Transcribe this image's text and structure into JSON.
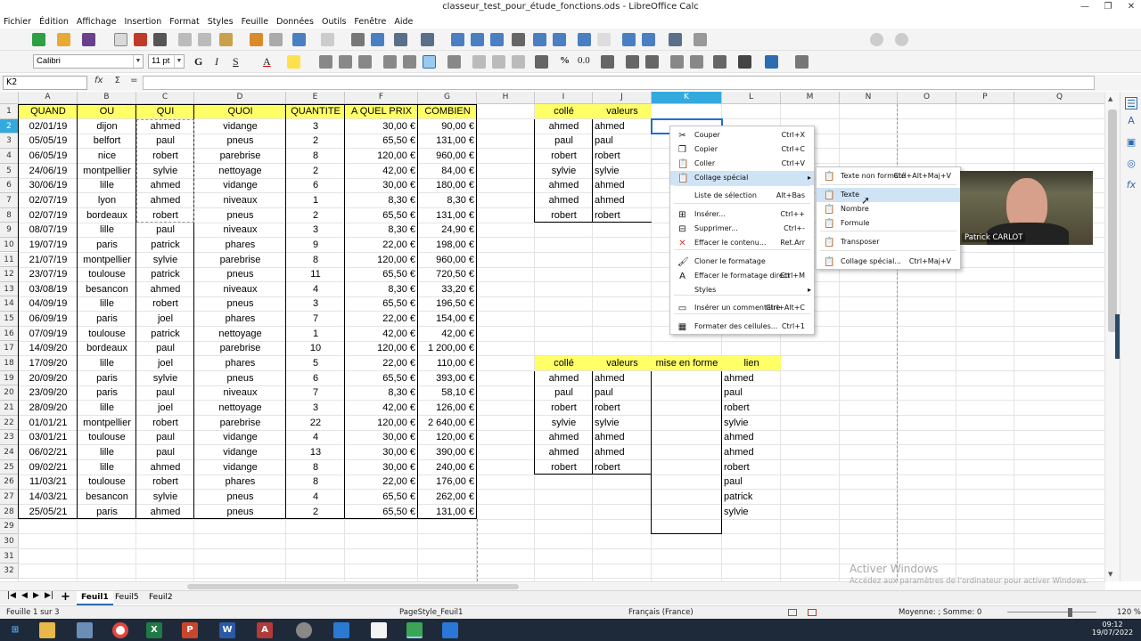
{
  "window": {
    "title": "classeur_test_pour_étude_fonctions.ods - LibreOffice Calc"
  },
  "menu": [
    "Fichier",
    "Édition",
    "Affichage",
    "Insertion",
    "Format",
    "Styles",
    "Feuille",
    "Données",
    "Outils",
    "Fenêtre",
    "Aide"
  ],
  "font": {
    "name": "Calibri",
    "size": "11 pt"
  },
  "formula": {
    "cell_ref": "K2",
    "fx": "fx",
    "sigma": "Σ",
    "equals": "=",
    "value": ""
  },
  "columns": [
    "A",
    "B",
    "C",
    "D",
    "E",
    "F",
    "G",
    "H",
    "I",
    "J",
    "K",
    "L",
    "M",
    "N",
    "O",
    "P",
    "Q"
  ],
  "selected_column": "K",
  "table_main": {
    "headers": [
      "QUAND",
      "OU",
      "QUI",
      "QUOI",
      "QUANTITE",
      "A QUEL PRIX",
      "COMBIEN"
    ],
    "rows": [
      [
        "02/01/19",
        "dijon",
        "ahmed",
        "vidange",
        "3",
        "30,00 €",
        "90,00 €"
      ],
      [
        "05/05/19",
        "belfort",
        "paul",
        "pneus",
        "2",
        "65,50 €",
        "131,00 €"
      ],
      [
        "06/05/19",
        "nice",
        "robert",
        "parebrise",
        "8",
        "120,00 €",
        "960,00 €"
      ],
      [
        "24/06/19",
        "montpellier",
        "sylvie",
        "nettoyage",
        "2",
        "42,00 €",
        "84,00 €"
      ],
      [
        "30/06/19",
        "lille",
        "ahmed",
        "vidange",
        "6",
        "30,00 €",
        "180,00 €"
      ],
      [
        "02/07/19",
        "lyon",
        "ahmed",
        "niveaux",
        "1",
        "8,30 €",
        "8,30 €"
      ],
      [
        "02/07/19",
        "bordeaux",
        "robert",
        "pneus",
        "2",
        "65,50 €",
        "131,00 €"
      ],
      [
        "08/07/19",
        "lille",
        "paul",
        "niveaux",
        "3",
        "8,30 €",
        "24,90 €"
      ],
      [
        "19/07/19",
        "paris",
        "patrick",
        "phares",
        "9",
        "22,00 €",
        "198,00 €"
      ],
      [
        "21/07/19",
        "montpellier",
        "sylvie",
        "parebrise",
        "8",
        "120,00 €",
        "960,00 €"
      ],
      [
        "23/07/19",
        "toulouse",
        "patrick",
        "pneus",
        "11",
        "65,50 €",
        "720,50 €"
      ],
      [
        "03/08/19",
        "besancon",
        "ahmed",
        "niveaux",
        "4",
        "8,30 €",
        "33,20 €"
      ],
      [
        "04/09/19",
        "lille",
        "robert",
        "pneus",
        "3",
        "65,50 €",
        "196,50 €"
      ],
      [
        "06/09/19",
        "paris",
        "joel",
        "phares",
        "7",
        "22,00 €",
        "154,00 €"
      ],
      [
        "07/09/19",
        "toulouse",
        "patrick",
        "nettoyage",
        "1",
        "42,00 €",
        "42,00 €"
      ],
      [
        "14/09/20",
        "bordeaux",
        "paul",
        "parebrise",
        "10",
        "120,00 €",
        "1 200,00 €"
      ],
      [
        "17/09/20",
        "lille",
        "joel",
        "phares",
        "5",
        "22,00 €",
        "110,00 €"
      ],
      [
        "20/09/20",
        "paris",
        "sylvie",
        "pneus",
        "6",
        "65,50 €",
        "393,00 €"
      ],
      [
        "23/09/20",
        "paris",
        "paul",
        "niveaux",
        "7",
        "8,30 €",
        "58,10 €"
      ],
      [
        "28/09/20",
        "lille",
        "joel",
        "nettoyage",
        "3",
        "42,00 €",
        "126,00 €"
      ],
      [
        "01/01/21",
        "montpellier",
        "robert",
        "parebrise",
        "22",
        "120,00 €",
        "2 640,00 €"
      ],
      [
        "03/01/21",
        "toulouse",
        "paul",
        "vidange",
        "4",
        "30,00 €",
        "120,00 €"
      ],
      [
        "06/02/21",
        "lille",
        "paul",
        "vidange",
        "13",
        "30,00 €",
        "390,00 €"
      ],
      [
        "09/02/21",
        "lille",
        "ahmed",
        "vidange",
        "8",
        "30,00 €",
        "240,00 €"
      ],
      [
        "11/03/21",
        "toulouse",
        "robert",
        "phares",
        "8",
        "22,00 €",
        "176,00 €"
      ],
      [
        "14/03/21",
        "besancon",
        "sylvie",
        "pneus",
        "4",
        "65,50 €",
        "262,00 €"
      ],
      [
        "25/05/21",
        "paris",
        "ahmed",
        "pneus",
        "2",
        "65,50 €",
        "131,00 €"
      ]
    ]
  },
  "table_top": {
    "headers": [
      "collé",
      "valeurs"
    ],
    "colle": [
      "ahmed",
      "paul",
      "robert",
      "sylvie",
      "ahmed",
      "ahmed",
      "robert"
    ],
    "valeurs": [
      "ahmed",
      "paul",
      "robert",
      "sylvie",
      "ahmed",
      "ahmed",
      "robert"
    ]
  },
  "table_bottom": {
    "headers": [
      "collé",
      "valeurs",
      "mise en forme",
      "lien"
    ],
    "colle": [
      "ahmed",
      "paul",
      "robert",
      "sylvie",
      "ahmed",
      "ahmed",
      "robert"
    ],
    "valeurs": [
      "ahmed",
      "paul",
      "robert",
      "sylvie",
      "ahmed",
      "ahmed",
      "robert"
    ],
    "lien": [
      "ahmed",
      "paul",
      "robert",
      "sylvie",
      "ahmed",
      "ahmed",
      "robert",
      "paul",
      "patrick",
      "sylvie"
    ]
  },
  "context_menu": [
    {
      "label": "Couper",
      "shortcut": "Ctrl+X",
      "icon": "scissors-icon"
    },
    {
      "label": "Copier",
      "shortcut": "Ctrl+C",
      "icon": "copy-icon"
    },
    {
      "label": "Coller",
      "shortcut": "Ctrl+V",
      "icon": "paste-icon"
    },
    {
      "label": "Collage spécial",
      "shortcut": "",
      "icon": "paste-special-icon"
    },
    {
      "label": "Liste de sélection",
      "shortcut": "Alt+Bas",
      "icon": ""
    },
    {
      "label": "Insérer...",
      "shortcut": "Ctrl++",
      "icon": "insert-cells-icon"
    },
    {
      "label": "Supprimer...",
      "shortcut": "Ctrl+-",
      "icon": "delete-cells-icon"
    },
    {
      "label": "Effacer le contenu...",
      "shortcut": "Ret.Arr",
      "icon": "clear-contents-icon"
    },
    {
      "label": "Cloner le formatage",
      "shortcut": "",
      "icon": "clone-format-icon"
    },
    {
      "label": "Effacer le formatage direct",
      "shortcut": "Ctrl+M",
      "icon": "clear-format-icon"
    },
    {
      "label": "Styles",
      "shortcut": "",
      "icon": ""
    },
    {
      "label": "Insérer un commentaire",
      "shortcut": "Ctrl+Alt+C",
      "icon": "comment-icon"
    },
    {
      "label": "Formater des cellules...",
      "shortcut": "Ctrl+1",
      "icon": "format-cells-icon"
    }
  ],
  "submenu": [
    {
      "label": "Texte non formaté",
      "shortcut": "Ctrl+Alt+Maj+V"
    },
    {
      "label": "Texte",
      "shortcut": ""
    },
    {
      "label": "Nombre",
      "shortcut": ""
    },
    {
      "label": "Formule",
      "shortcut": ""
    },
    {
      "label": "Transposer",
      "shortcut": ""
    },
    {
      "label": "Collage spécial...",
      "shortcut": "Ctrl+Maj+V"
    }
  ],
  "webcam_label": "Patrick CARLOT",
  "sheet_tabs": [
    "Feuil1",
    "Feuil5",
    "Feuil2"
  ],
  "active_tab": "Feuil1",
  "status": {
    "sheet": "Feuille 1 sur 3",
    "pagestyle": "PageStyle_Feuil1",
    "language": "Français (France)",
    "sum": "Moyenne: ; Somme: 0",
    "zoom": "120 %"
  },
  "watermark": {
    "title": "Activer Windows",
    "sub": "Accédez aux paramètres de l'ordinateur pour activer Windows."
  },
  "clock": {
    "time": "09:12",
    "date": "19/07/2022"
  }
}
